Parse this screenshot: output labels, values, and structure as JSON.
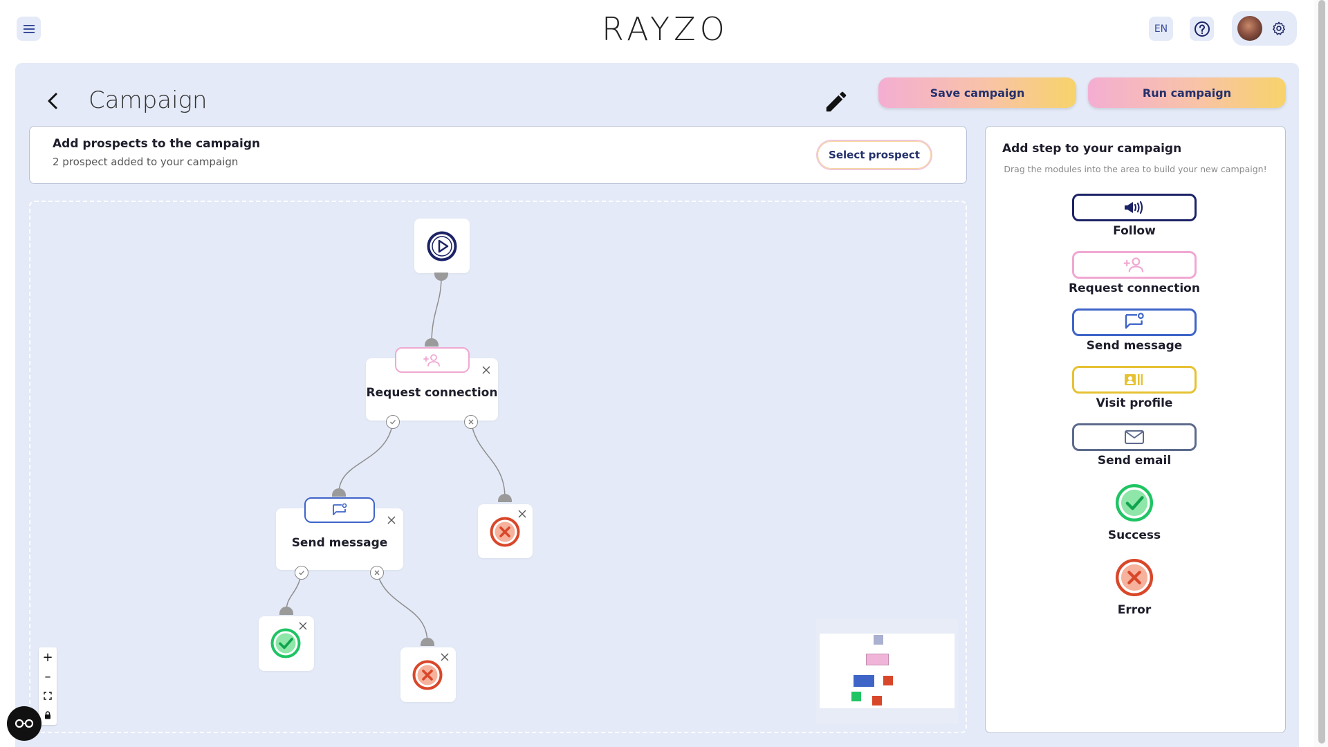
{
  "topbar": {
    "logo_text": "RAYZO",
    "language": "EN"
  },
  "header": {
    "title": "Campaign",
    "save_label": "Save campaign",
    "run_label": "Run campaign"
  },
  "prospects": {
    "title": "Add prospects to the campaign",
    "subtitle": "2 prospect added to your campaign",
    "select_label": "Select prospect"
  },
  "flow": {
    "nodes": [
      {
        "id": "start",
        "type": "start",
        "icon": "play-icon"
      },
      {
        "id": "request",
        "type": "request_connection",
        "label": "Request connection",
        "icon": "add-user-icon"
      },
      {
        "id": "message",
        "type": "send_message",
        "label": "Send message",
        "icon": "message-icon"
      },
      {
        "id": "error1",
        "type": "error",
        "icon": "error-icon"
      },
      {
        "id": "success1",
        "type": "success",
        "icon": "success-icon"
      },
      {
        "id": "error2",
        "type": "error",
        "icon": "error-icon"
      }
    ]
  },
  "zoom_controls": {
    "zoom_in": "+",
    "zoom_out": "–"
  },
  "steps_panel": {
    "title": "Add step to your campaign",
    "subtitle": "Drag the modules into the area to build your new campaign!",
    "modules": [
      {
        "label": "Follow",
        "icon": "megaphone-icon",
        "color": "#1b2266"
      },
      {
        "label": "Request connection",
        "icon": "add-user-icon",
        "color": "#f0a8d2"
      },
      {
        "label": "Send message",
        "icon": "message-icon",
        "color": "#3e64c8"
      },
      {
        "label": "Visit profile",
        "icon": "profile-card-icon",
        "color": "#e6c233"
      },
      {
        "label": "Send email",
        "icon": "mail-icon",
        "color": "#5c6b8c"
      },
      {
        "label": "Success",
        "icon": "success-icon",
        "color": "#1fc463"
      },
      {
        "label": "Error",
        "icon": "error-icon",
        "color": "#d9472a"
      }
    ]
  },
  "colors": {
    "background_panel": "#e4eaf7",
    "start": "#1b2266",
    "request_connection": "#f0a8d2",
    "send_message": "#3e64c8",
    "visit_profile": "#e6c233",
    "success": "#1fc463",
    "error": "#d9472a"
  }
}
